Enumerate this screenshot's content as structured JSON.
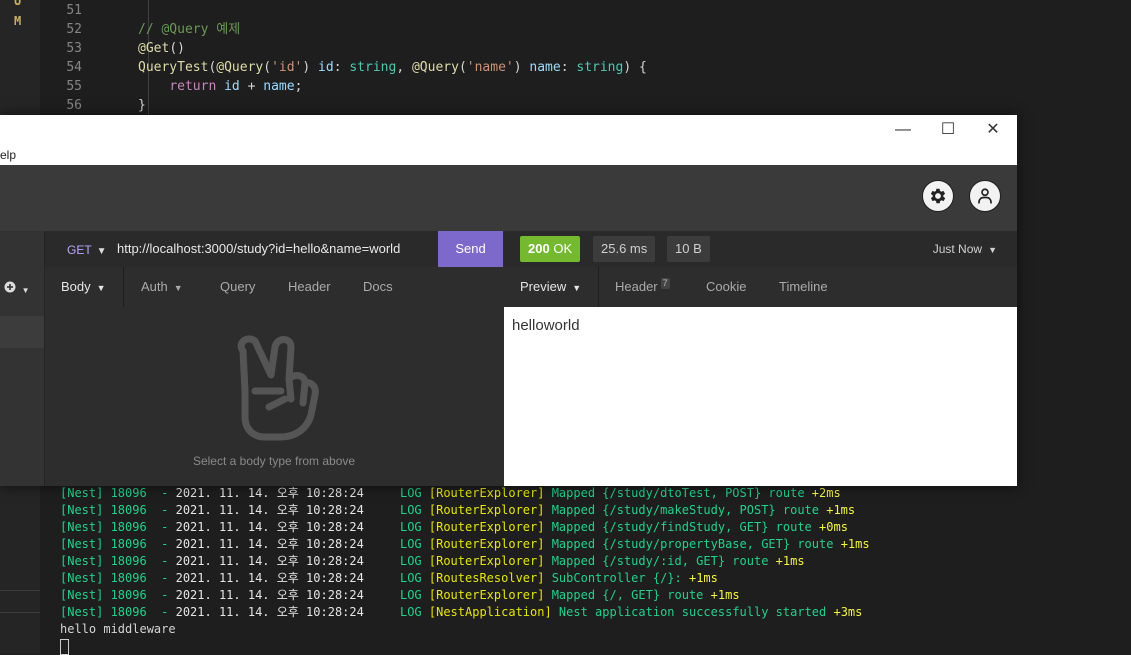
{
  "vscode": {
    "git_marks": [
      "U",
      "M"
    ],
    "editor_lines": [
      {
        "num": "51",
        "tokens": []
      },
      {
        "num": "52",
        "tokens": [
          {
            "cls": "c-comment",
            "text": "// @Query 예제"
          }
        ]
      },
      {
        "num": "53",
        "tokens": [
          {
            "cls": "c-dec",
            "text": "@Get"
          },
          {
            "cls": "c-plain",
            "text": "()"
          }
        ]
      },
      {
        "num": "54",
        "tokens": [
          {
            "cls": "c-fn",
            "text": "QueryTest"
          },
          {
            "cls": "c-plain",
            "text": "("
          },
          {
            "cls": "c-dec",
            "text": "@Query"
          },
          {
            "cls": "c-plain",
            "text": "("
          },
          {
            "cls": "c-str",
            "text": "'id'"
          },
          {
            "cls": "c-plain",
            "text": ") "
          },
          {
            "cls": "c-var",
            "text": "id"
          },
          {
            "cls": "c-plain",
            "text": ": "
          },
          {
            "cls": "c-type",
            "text": "string"
          },
          {
            "cls": "c-plain",
            "text": ", "
          },
          {
            "cls": "c-dec",
            "text": "@Query"
          },
          {
            "cls": "c-plain",
            "text": "("
          },
          {
            "cls": "c-str",
            "text": "'name'"
          },
          {
            "cls": "c-plain",
            "text": ") "
          },
          {
            "cls": "c-var",
            "text": "name"
          },
          {
            "cls": "c-plain",
            "text": ": "
          },
          {
            "cls": "c-type",
            "text": "string"
          },
          {
            "cls": "c-plain",
            "text": ") {"
          }
        ]
      },
      {
        "num": "55",
        "tokens": [
          {
            "cls": "c-plain",
            "text": "    "
          },
          {
            "cls": "c-kw",
            "text": "return"
          },
          {
            "cls": "c-plain",
            "text": " "
          },
          {
            "cls": "c-var",
            "text": "id"
          },
          {
            "cls": "c-plain",
            "text": " + "
          },
          {
            "cls": "c-var",
            "text": "name"
          },
          {
            "cls": "c-plain",
            "text": ";"
          }
        ]
      },
      {
        "num": "56",
        "tokens": [
          {
            "cls": "c-plain",
            "text": "}"
          }
        ]
      }
    ],
    "terminal_lines": [
      {
        "prefix": "[Nest] 18096  - ",
        "date": "2021. 11. 14. 오후 10:28:24",
        "level": "     LOG ",
        "ctx": "[RouterExplorer]",
        "msg": " Mapped {/study/dtoTest, POST} route ",
        "ms": "+2ms"
      },
      {
        "prefix": "[Nest] 18096  - ",
        "date": "2021. 11. 14. 오후 10:28:24",
        "level": "     LOG ",
        "ctx": "[RouterExplorer]",
        "msg": " Mapped {/study/makeStudy, POST} route ",
        "ms": "+1ms"
      },
      {
        "prefix": "[Nest] 18096  - ",
        "date": "2021. 11. 14. 오후 10:28:24",
        "level": "     LOG ",
        "ctx": "[RouterExplorer]",
        "msg": " Mapped {/study/findStudy, GET} route ",
        "ms": "+0ms"
      },
      {
        "prefix": "[Nest] 18096  - ",
        "date": "2021. 11. 14. 오후 10:28:24",
        "level": "     LOG ",
        "ctx": "[RouterExplorer]",
        "msg": " Mapped {/study/propertyBase, GET} route ",
        "ms": "+1ms"
      },
      {
        "prefix": "[Nest] 18096  - ",
        "date": "2021. 11. 14. 오후 10:28:24",
        "level": "     LOG ",
        "ctx": "[RouterExplorer]",
        "msg": " Mapped {/study/:id, GET} route ",
        "ms": "+1ms"
      },
      {
        "prefix": "[Nest] 18096  - ",
        "date": "2021. 11. 14. 오후 10:28:24",
        "level": "     LOG ",
        "ctx": "[RoutesResolver]",
        "msg": " SubController {/}: ",
        "ms": "+1ms"
      },
      {
        "prefix": "[Nest] 18096  - ",
        "date": "2021. 11. 14. 오후 10:28:24",
        "level": "     LOG ",
        "ctx": "[RouterExplorer]",
        "msg": " Mapped {/, GET} route ",
        "ms": "+1ms"
      },
      {
        "prefix": "[Nest] 18096  - ",
        "date": "2021. 11. 14. 오후 10:28:24",
        "level": "     LOG ",
        "ctx": "[NestApplication]",
        "msg": " Nest application successfully started ",
        "ms": "+3ms"
      }
    ],
    "terminal_plain": "hello middleware"
  },
  "insomnia": {
    "menu_fragment": "elp",
    "window_controls": {
      "minimize": "—",
      "maximize": "☐",
      "close": "✕"
    },
    "icons": {
      "settings": "gear-icon",
      "account": "user-icon",
      "add": "plus-circle-icon"
    },
    "request": {
      "method": "GET",
      "url": "http://localhost:3000/study?id=hello&name=world",
      "send_label": "Send",
      "tabs": [
        "Body",
        "Auth",
        "Query",
        "Header",
        "Docs"
      ],
      "empty_message": "Select a body type from above"
    },
    "response": {
      "status_code": "200",
      "status_text": "OK",
      "time": "25.6 ms",
      "size": "10 B",
      "history_label": "Just Now",
      "tabs": {
        "preview": "Preview",
        "header": "Header",
        "header_count": "7",
        "cookie": "Cookie",
        "timeline": "Timeline"
      },
      "body": "helloworld"
    },
    "colors": {
      "send": "#7d69cb",
      "status_ok": "#74b930",
      "method": "#b9a6ff"
    }
  }
}
